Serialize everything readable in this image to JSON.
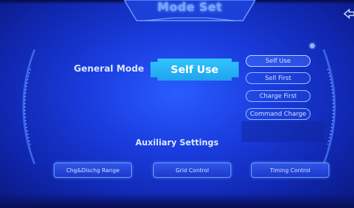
{
  "header": {
    "title": "Mode Set"
  },
  "general_mode": {
    "label": "General Mode",
    "selected": "Self Use",
    "options": [
      "Self Use",
      "Sell First",
      "Charge First",
      "Command Charge"
    ]
  },
  "auxiliary": {
    "label": "Auxiliary Settings",
    "buttons": [
      "Chg&Dischg Range",
      "Grid Control",
      "Timing Control"
    ]
  },
  "colors": {
    "background": "#1a3ddf",
    "accent": "#33c4ff",
    "text": "#d8e6ff"
  }
}
